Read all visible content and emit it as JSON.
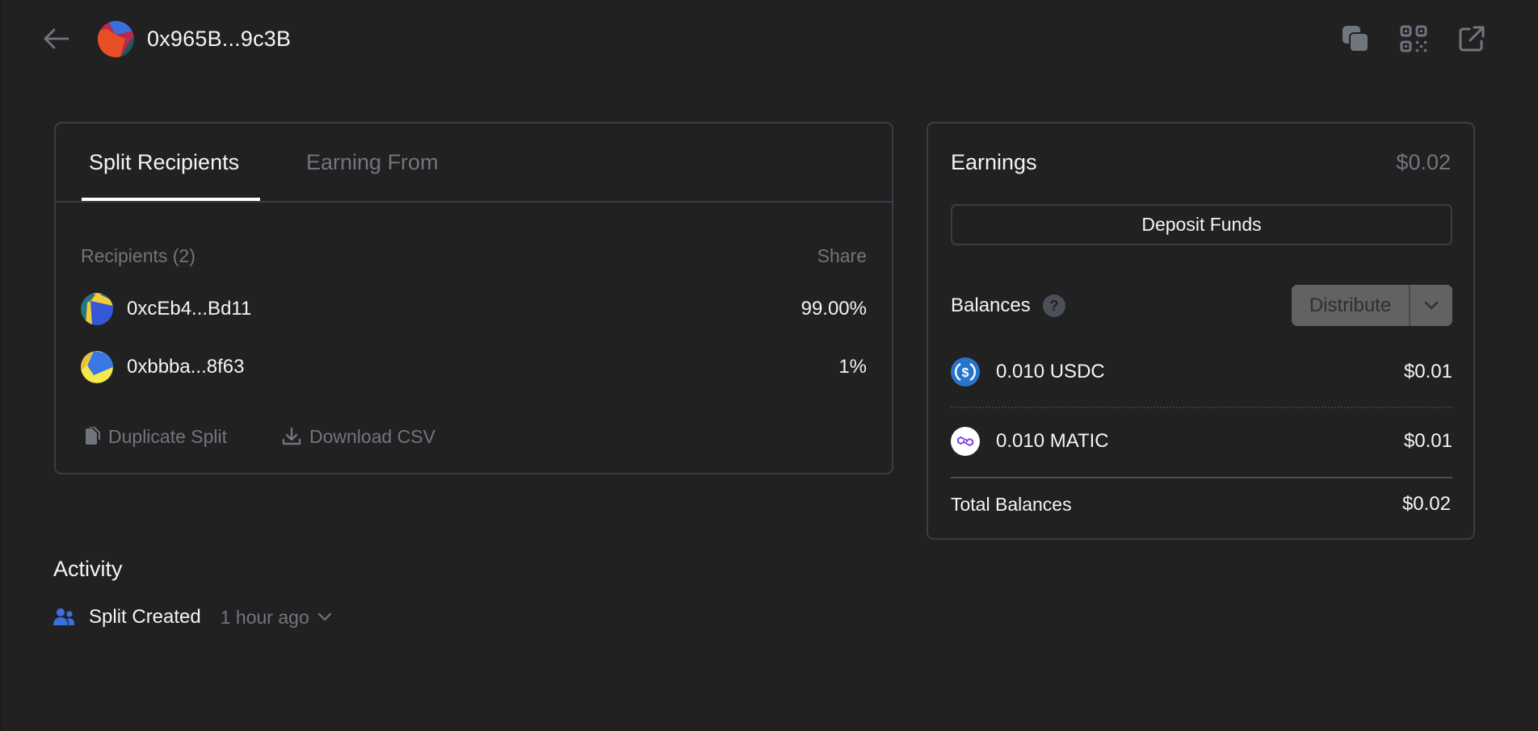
{
  "header": {
    "title": "0x965B...9c3B",
    "icons": [
      "back-arrow-icon",
      "copy-icon",
      "qr-code-icon",
      "external-link-icon"
    ]
  },
  "split_card": {
    "tabs": [
      {
        "label": "Split Recipients",
        "active": true
      },
      {
        "label": "Earning From",
        "active": false
      }
    ],
    "recipients_header": "Recipients (2)",
    "share_header": "Share",
    "recipients": [
      {
        "address": "0xcEb4...Bd11",
        "share": "99.00%"
      },
      {
        "address": "0xbbba...8f63",
        "share": "1%"
      }
    ],
    "actions": {
      "duplicate": "Duplicate Split",
      "download": "Download CSV"
    }
  },
  "earnings_card": {
    "title": "Earnings",
    "total": "$0.02",
    "deposit_label": "Deposit Funds",
    "balances_title": "Balances",
    "help_glyph": "?",
    "distribute_label": "Distribute",
    "tokens": [
      {
        "amount": "0.010 USDC",
        "value": "$0.01",
        "icon": "usdc-icon",
        "color": "#2775ca"
      },
      {
        "amount": "0.010 MATIC",
        "value": "$0.01",
        "icon": "matic-icon",
        "color": "#8247e5"
      }
    ],
    "total_label": "Total Balances",
    "total_value": "$0.02"
  },
  "activity": {
    "title": "Activity",
    "items": [
      {
        "label": "Split Created",
        "time": "1 hour ago"
      }
    ]
  },
  "colors": {
    "background": "#212121",
    "border": "#383d48",
    "muted_text": "#71757f",
    "accent_blue": "#3b6fe0"
  }
}
